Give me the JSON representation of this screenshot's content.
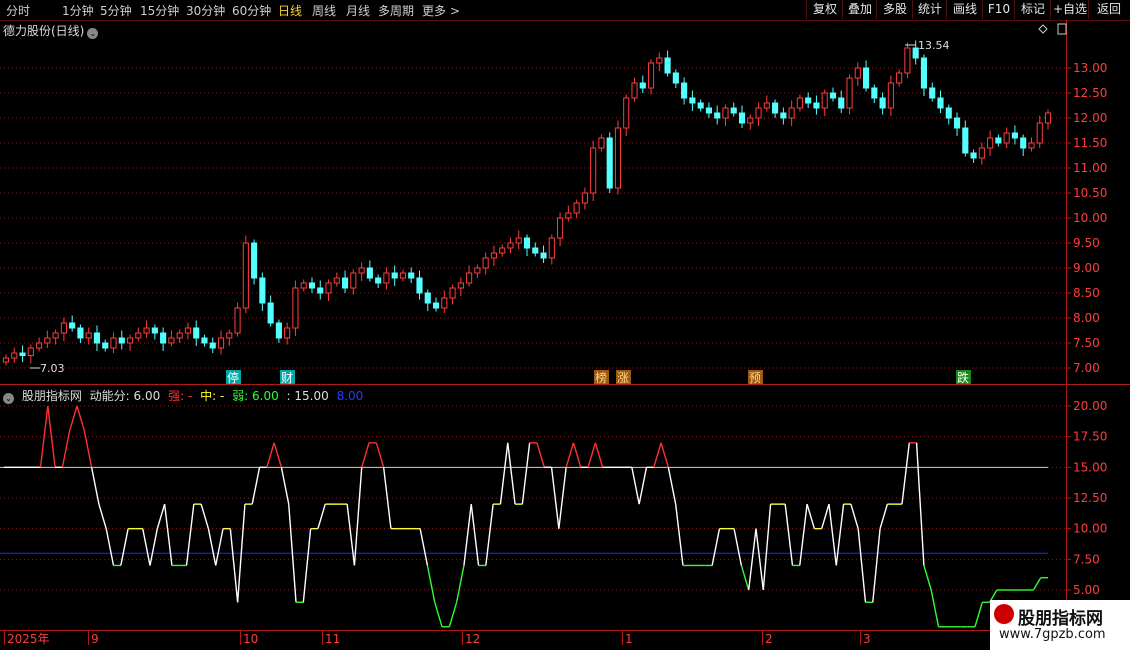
{
  "toolbar": {
    "periods": [
      "分时",
      "1分钟",
      "5分钟",
      "15分钟",
      "30分钟",
      "60分钟",
      "日线",
      "周线",
      "月线",
      "多周期",
      "更多 >"
    ],
    "active_period": "日线",
    "buttons": [
      "复权",
      "叠加",
      "多股",
      "统计",
      "画线",
      "F10",
      "标记",
      "+自选",
      "返回"
    ]
  },
  "stock": {
    "title": "德力股份(日线)"
  },
  "price_axis": {
    "labels": [
      "13.00",
      "12.50",
      "12.00",
      "11.50",
      "11.00",
      "10.50",
      "10.00",
      "9.50",
      "9.00",
      "8.50",
      "8.00",
      "7.50",
      "7.00"
    ]
  },
  "annotations": {
    "high_label": "13.54",
    "low_label": "7.03",
    "markers": [
      {
        "text": "停",
        "type": "cyan"
      },
      {
        "text": "财",
        "type": "cyan"
      },
      {
        "text": "榜",
        "type": "orange"
      },
      {
        "text": "涨",
        "type": "orange"
      },
      {
        "text": "预",
        "type": "orange"
      },
      {
        "text": "跌",
        "type": "green"
      }
    ]
  },
  "indicator": {
    "title": "股朋指标网",
    "score_label": "动能分: 6.00",
    "strong_label": "强: -",
    "mid_label": "中: -",
    "weak_label": "弱: 6.00",
    "upper_label": ": 15.00",
    "lower_label": "8.00",
    "axis_labels": [
      "20.00",
      "17.50",
      "15.00",
      "12.50",
      "10.00",
      "7.50",
      "5.00"
    ],
    "upper_line": 15,
    "lower_line": 8
  },
  "time_axis": {
    "labels": [
      "2025年",
      "9",
      "10",
      "11",
      "12",
      "1",
      "2",
      "3"
    ]
  },
  "watermark": {
    "line1": "股朋指标网",
    "line2": "www.7gpzb.com"
  },
  "colors": {
    "up": "#ff3c3c",
    "down": "#54ffff",
    "strong": "#ff3030",
    "mid": "#ffff30",
    "weak": "#30ff30",
    "neutral": "#ffffff",
    "lower": "#1a2aff"
  },
  "chart_data": [
    {
      "type": "candlestick",
      "title": "德力股份(日线)",
      "ylim": [
        6.8,
        13.7
      ],
      "close_series": [
        7.2,
        7.3,
        7.25,
        7.4,
        7.5,
        7.6,
        7.7,
        7.9,
        7.8,
        7.6,
        7.7,
        7.5,
        7.4,
        7.6,
        7.5,
        7.6,
        7.7,
        7.8,
        7.7,
        7.5,
        7.6,
        7.7,
        7.8,
        7.6,
        7.5,
        7.4,
        7.6,
        7.7,
        8.2,
        9.5,
        8.8,
        8.3,
        7.9,
        7.6,
        7.8,
        8.6,
        8.7,
        8.6,
        8.5,
        8.7,
        8.8,
        8.6,
        8.9,
        9.0,
        8.8,
        8.7,
        8.9,
        8.8,
        8.9,
        8.8,
        8.5,
        8.3,
        8.2,
        8.4,
        8.6,
        8.7,
        8.9,
        9.0,
        9.2,
        9.3,
        9.4,
        9.5,
        9.6,
        9.4,
        9.3,
        9.2,
        9.6,
        10.0,
        10.1,
        10.3,
        10.5,
        11.4,
        11.6,
        10.6,
        11.8,
        12.4,
        12.7,
        12.6,
        13.1,
        13.2,
        12.9,
        12.7,
        12.4,
        12.3,
        12.2,
        12.1,
        12.0,
        12.2,
        12.1,
        11.9,
        12.0,
        12.2,
        12.3,
        12.1,
        12.0,
        12.2,
        12.4,
        12.3,
        12.2,
        12.5,
        12.4,
        12.2,
        12.8,
        13.0,
        12.6,
        12.4,
        12.2,
        12.7,
        12.9,
        13.4,
        13.2,
        12.6,
        12.4,
        12.2,
        12.0,
        11.8,
        11.3,
        11.2,
        11.4,
        11.6,
        11.5,
        11.7,
        11.6,
        11.4,
        11.5,
        11.9,
        12.1
      ]
    },
    {
      "type": "line",
      "title": "股朋指标网",
      "series": [
        {
          "name": "动能分",
          "values": [
            15,
            15,
            15,
            15,
            15,
            15,
            20,
            15,
            15,
            18,
            20,
            18,
            15,
            12,
            10,
            7,
            7,
            10,
            10,
            10,
            7,
            10,
            12,
            7,
            7,
            7,
            12,
            12,
            10,
            7,
            10,
            10,
            4,
            12,
            12,
            15,
            15,
            17,
            15,
            12,
            4,
            4,
            10,
            10,
            12,
            12,
            12,
            12,
            7,
            15,
            17,
            17,
            15,
            10,
            10,
            10,
            10,
            10,
            7,
            4,
            2,
            2,
            4,
            7,
            12,
            7,
            7,
            12,
            12,
            17,
            12,
            12,
            17,
            17,
            15,
            15,
            10,
            15,
            17,
            15,
            15,
            17,
            15,
            15,
            15,
            15,
            15,
            12,
            15,
            15,
            17,
            15,
            12,
            7,
            7,
            7,
            7,
            7,
            10,
            10,
            10,
            7,
            5,
            10,
            5,
            12,
            12,
            12,
            7,
            7,
            12,
            10,
            10,
            12,
            7,
            12,
            12,
            10,
            4,
            4,
            10,
            12,
            12,
            12,
            17,
            17,
            7,
            5,
            2,
            2,
            2,
            2,
            2,
            2,
            4,
            4,
            5,
            5,
            5,
            5,
            5,
            5,
            6,
            6
          ]
        }
      ],
      "ylim": [
        1.5,
        21.5
      ],
      "reference_lines": [
        15,
        8
      ]
    }
  ]
}
